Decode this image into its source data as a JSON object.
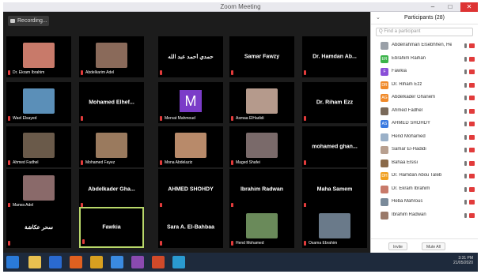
{
  "window": {
    "title": "Zoom Meeting",
    "minimize": "–",
    "maximize": "□",
    "close": "✕"
  },
  "recording": {
    "label": "Recording..."
  },
  "tiles": [
    {
      "type": "photo",
      "label": "Dr. Ekram Ibrahim",
      "color": "#c87a6a"
    },
    {
      "type": "photo",
      "label": "Abdelkarim Adel",
      "color": "#8a6a5a"
    },
    {
      "type": "name",
      "name": "حمدي أحمد عبد الله"
    },
    {
      "type": "name",
      "name": "Samar Fawzy"
    },
    {
      "type": "name",
      "name": "Dr. Hamdan Ab..."
    },
    {
      "type": "photo",
      "label": "Wael Elsayed",
      "color": "#5b8fb8"
    },
    {
      "type": "name",
      "name": "Mohamed Elhef..."
    },
    {
      "type": "avatar",
      "letter": "M",
      "label": "Mervat Mahmoud"
    },
    {
      "type": "photo",
      "label": "Asmaa ElHadidi",
      "color": "#b59a8c"
    },
    {
      "type": "name",
      "name": "Dr. Riham Ezz"
    },
    {
      "type": "photo",
      "label": "Ahmed Fadhel",
      "color": "#6a5a4a"
    },
    {
      "type": "photo",
      "label": "Mohamed Fayez",
      "color": "#9a7a5e"
    },
    {
      "type": "photo",
      "label": "Mona Abdelaziz",
      "color": "#b88a6a"
    },
    {
      "type": "photo",
      "label": "Maged Shafei",
      "color": "#7a6a6a"
    },
    {
      "type": "name",
      "name": "mohamed ghan..."
    },
    {
      "type": "photo",
      "label": "Marwa Adel",
      "color": "#8a6a6a"
    },
    {
      "type": "name",
      "name": "Abdelkader Gha..."
    },
    {
      "type": "name",
      "name": "AHMED SHOHDY"
    },
    {
      "type": "name",
      "name": "Ibrahim Radwan"
    },
    {
      "type": "name",
      "name": "Maha Samem"
    },
    {
      "type": "name",
      "name": "سحر عكاشة"
    },
    {
      "type": "name",
      "name": "Fawkia",
      "active": true
    },
    {
      "type": "name",
      "name": "Sara A. El-Bahbaa"
    },
    {
      "type": "photo",
      "label": "Hend Mohamed",
      "color": "#6a8a5a"
    },
    {
      "type": "photo",
      "label": "Osama Ebrahim",
      "color": "#6a7a8a"
    }
  ],
  "participants": {
    "title": "Participants (28)",
    "collapse_icon": "⌄",
    "search_placeholder": "Q Find a participant",
    "items": [
      {
        "name": "Abdelrahman Elsebhhen, Hei...",
        "color": "#9aa0a8",
        "initials": ""
      },
      {
        "name": "Ebrahim Raihan",
        "color": "#3bb34a",
        "initials": "ER"
      },
      {
        "name": "Fawkia",
        "color": "#8a4fd8",
        "initials": "F"
      },
      {
        "name": "Dr. Riham Ezz",
        "color": "#f08a2a",
        "initials": "DR"
      },
      {
        "name": "Abdelkader Ghanem",
        "color": "#f08a2a",
        "initials": "AG"
      },
      {
        "name": "Ahmed Fadhel",
        "color": "#7a6a5a",
        "initials": ""
      },
      {
        "name": "AHMED SHOHDY",
        "color": "#3a7ae0",
        "initials": "AS"
      },
      {
        "name": "Hend Mohamed",
        "color": "#9ab0c8",
        "initials": ""
      },
      {
        "name": "Samar El-Hadidi",
        "color": "#b8a090",
        "initials": ""
      },
      {
        "name": "Bahaa Elsisi",
        "color": "#8a6a4a",
        "initials": ""
      },
      {
        "name": "Dr. Hamdan Abou Taleb",
        "color": "#f0a020",
        "initials": "DH"
      },
      {
        "name": "Dr. Ekram Ibrahim",
        "color": "#c87a6a",
        "initials": ""
      },
      {
        "name": "Heba Mahrous",
        "color": "#7a8a9a",
        "initials": ""
      },
      {
        "name": "Ibrahim Radwan",
        "color": "#9a7a6a",
        "initials": ""
      }
    ],
    "invite_label": "Invite",
    "mute_all_label": "Mute All"
  },
  "taskbar": {
    "time": "3:31 PM",
    "date": "21/05/2020"
  }
}
